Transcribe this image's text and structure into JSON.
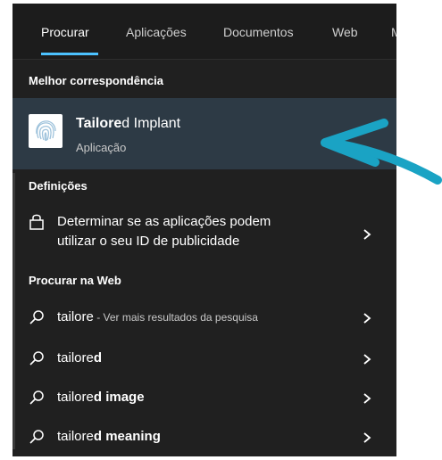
{
  "tabs": [
    {
      "label": "Procurar",
      "active": true
    },
    {
      "label": "Aplicações"
    },
    {
      "label": "Documentos"
    },
    {
      "label": "Web"
    },
    {
      "label": "M"
    }
  ],
  "best_match": {
    "header": "Melhor correspondência",
    "title_bold": "Tailore",
    "title_rest": "d Implant",
    "subtitle": "Aplicação"
  },
  "settings": {
    "header": "Definições",
    "item_line1": "Determinar se as aplicações podem",
    "item_line2": "utilizar o seu ID de publicidade"
  },
  "web": {
    "header": "Procurar na Web",
    "items": [
      {
        "query": "tailore",
        "bold": "",
        "suffix": " - Ver mais resultados da pesquisa"
      },
      {
        "query": "tailore",
        "bold": "d",
        "suffix": ""
      },
      {
        "query": "tailore",
        "bold": "d image",
        "suffix": ""
      },
      {
        "query": "tailore",
        "bold": "d meaning",
        "suffix": ""
      }
    ]
  },
  "colors": {
    "accent": "#4cc2ff",
    "highlight_bg": "#2d3a45",
    "panel_bg": "#202020",
    "annotation_arrow": "#1aa3c4"
  }
}
